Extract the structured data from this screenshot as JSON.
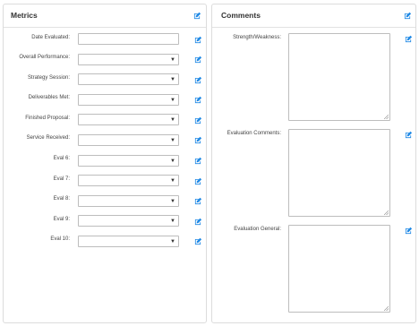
{
  "metrics": {
    "title": "Metrics",
    "icon": "edit-icon",
    "fields": [
      {
        "label": "Date Evaluated:",
        "type": "text",
        "value": ""
      },
      {
        "label": "Overall Performance:",
        "type": "select",
        "value": ""
      },
      {
        "label": "Strategy Session:",
        "type": "select",
        "value": ""
      },
      {
        "label": "Deliverables Met:",
        "type": "select",
        "value": ""
      },
      {
        "label": "Finished Proposal:",
        "type": "select",
        "value": ""
      },
      {
        "label": "Service Received:",
        "type": "select",
        "value": ""
      },
      {
        "label": "Eval 6:",
        "type": "select",
        "value": ""
      },
      {
        "label": "Eval 7:",
        "type": "select",
        "value": ""
      },
      {
        "label": "Eval 8:",
        "type": "select",
        "value": ""
      },
      {
        "label": "Eval 9:",
        "type": "select",
        "value": ""
      },
      {
        "label": "Eval 10:",
        "type": "select",
        "value": ""
      }
    ]
  },
  "comments": {
    "title": "Comments",
    "icon": "edit-icon",
    "fields": [
      {
        "label": "Strength/Weakness:",
        "value": ""
      },
      {
        "label": "Evaluation Comments:",
        "value": ""
      },
      {
        "label": "Evaluation General:",
        "value": ""
      }
    ]
  },
  "colors": {
    "accent": "#1e88e5"
  }
}
